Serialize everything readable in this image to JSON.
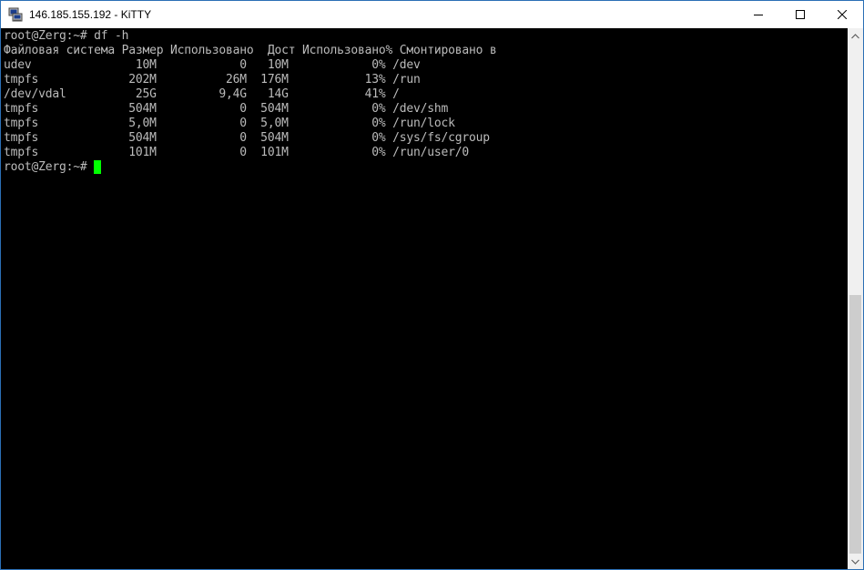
{
  "window": {
    "title": "146.185.155.192 - KiTTY",
    "icons": {
      "app": "putty-computer-icon",
      "minimize": "minimize-icon",
      "maximize": "maximize-icon",
      "close": "close-icon"
    }
  },
  "terminal": {
    "colors": {
      "background": "#000000",
      "text": "#bbbbbb",
      "cursor": "#00ff00"
    },
    "lines": [
      "root@Zerg:~# df -h",
      "Файловая система Размер Использовано  Дост Использовано% Смонтировано в",
      "udev               10M            0   10M            0% /dev",
      "tmpfs             202M          26M  176M           13% /run",
      "/dev/vdal          25G         9,4G   14G           41% /",
      "tmpfs             504M            0  504M            0% /dev/shm",
      "tmpfs             5,0M            0  5,0M            0% /run/lock",
      "tmpfs             504M            0  504M            0% /sys/fs/cgroup",
      "tmpfs             101M            0  101M            0% /run/user/0"
    ],
    "prompt": "root@Zerg:~# "
  }
}
